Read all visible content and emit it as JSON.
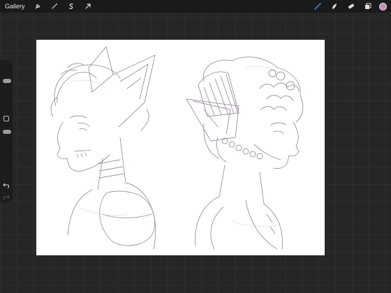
{
  "topbar": {
    "gallery_label": "Gallery",
    "left_tools": [
      "wrench-icon",
      "magic-wand-icon",
      "selection-icon",
      "transform-arrow-icon"
    ],
    "right_tools": [
      "brush-icon",
      "smudge-icon",
      "eraser-icon",
      "layers-icon"
    ],
    "active_color": "#c68ab8"
  },
  "sidebar": {
    "controls": [
      "brush-size-slider",
      "modify-button",
      "opacity-slider",
      "undo-button",
      "redo-button"
    ]
  },
  "canvas": {
    "background": "#ffffff",
    "sketch_stroke": "#8c7c94"
  }
}
